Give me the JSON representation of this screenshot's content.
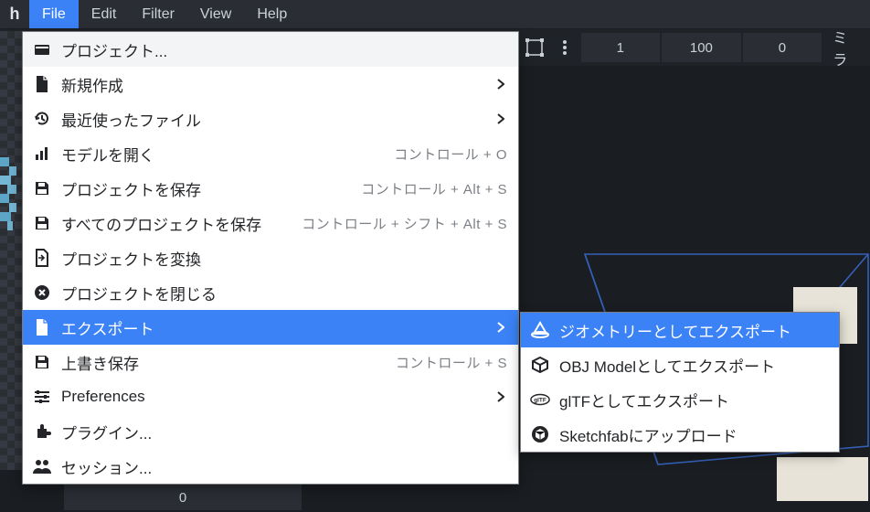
{
  "app": {
    "logo": "h"
  },
  "menubar": {
    "file": "File",
    "edit": "Edit",
    "filter": "Filter",
    "view": "View",
    "help": "Help"
  },
  "toolbar": {
    "val1": "1",
    "val2": "100",
    "val3": "0",
    "mirror": "ミラ"
  },
  "dropdown": {
    "project": "プロジェクト...",
    "new": "新規作成",
    "recent": "最近使ったファイル",
    "open": "モデルを開く",
    "open_sc": "コントロール + O",
    "save_project": "プロジェクトを保存",
    "save_project_sc": "コントロール + Alt + S",
    "save_all": "すべてのプロジェクトを保存",
    "save_all_sc": "コントロール + シフト + Alt + S",
    "convert": "プロジェクトを変換",
    "close": "プロジェクトを閉じる",
    "export": "エクスポート",
    "save_overwrite": "上書き保存",
    "save_overwrite_sc": "コントロール + S",
    "prefs": "Preferences",
    "plugins": "プラグイン...",
    "session": "セッション..."
  },
  "submenu": {
    "geom": "ジオメトリーとしてエクスポート",
    "obj": "OBJ Modelとしてエクスポート",
    "gltf": "glTFとしてエクスポート",
    "sketchfab": "Sketchfabにアップロード"
  },
  "bottom": {
    "val": "0"
  }
}
